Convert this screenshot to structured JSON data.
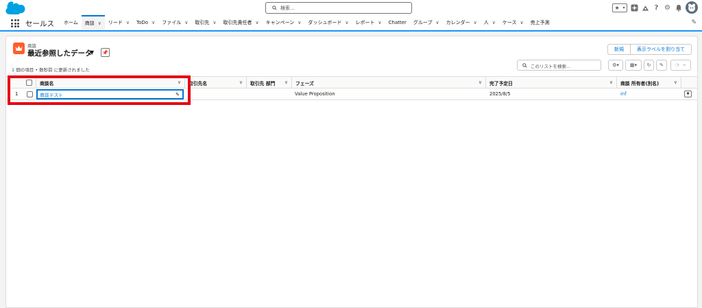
{
  "header": {
    "search_placeholder": "検索..."
  },
  "nav": {
    "app_name": "セールス",
    "tabs": [
      {
        "label": "ホーム",
        "chevron": false,
        "active": false
      },
      {
        "label": "商談",
        "chevron": true,
        "active": true
      },
      {
        "label": "リード",
        "chevron": true,
        "active": false
      },
      {
        "label": "ToDo",
        "chevron": true,
        "active": false
      },
      {
        "label": "ファイル",
        "chevron": true,
        "active": false
      },
      {
        "label": "取引先",
        "chevron": true,
        "active": false
      },
      {
        "label": "取引先責任者",
        "chevron": true,
        "active": false
      },
      {
        "label": "キャンペーン",
        "chevron": true,
        "active": false
      },
      {
        "label": "ダッシュボード",
        "chevron": true,
        "active": false
      },
      {
        "label": "レポート",
        "chevron": true,
        "active": false
      },
      {
        "label": "Chatter",
        "chevron": false,
        "active": false
      },
      {
        "label": "グループ",
        "chevron": true,
        "active": false
      },
      {
        "label": "カレンダー",
        "chevron": true,
        "active": false
      },
      {
        "label": "人",
        "chevron": true,
        "active": false
      },
      {
        "label": "ケース",
        "chevron": true,
        "active": false
      },
      {
        "label": "売上予測",
        "chevron": false,
        "active": false
      }
    ]
  },
  "list": {
    "object_label": "商談",
    "title": "最近参照したデータ",
    "new_button": "新規",
    "assign_label_button": "表示ラベルを割り当て",
    "meta": "1 個の項目 • 数秒前 に更新されました",
    "search_placeholder": "このリストを検索...",
    "columns": {
      "name": "商談名",
      "account": "取引先名",
      "account_dept": "取引先 部門",
      "stage": "フェーズ",
      "close_date": "完了予定日",
      "owner": "商談 所有者(別名)"
    },
    "rows": [
      {
        "num": "1",
        "name": "商談テスト",
        "account": "",
        "account_dept": "",
        "stage": "Value Proposition",
        "close_date": "2025/8/5",
        "owner": "inf"
      }
    ]
  },
  "colors": {
    "brand_blue": "#0176d3",
    "opportunity_orange": "#ff5d2d",
    "highlight_red": "#e60012"
  }
}
